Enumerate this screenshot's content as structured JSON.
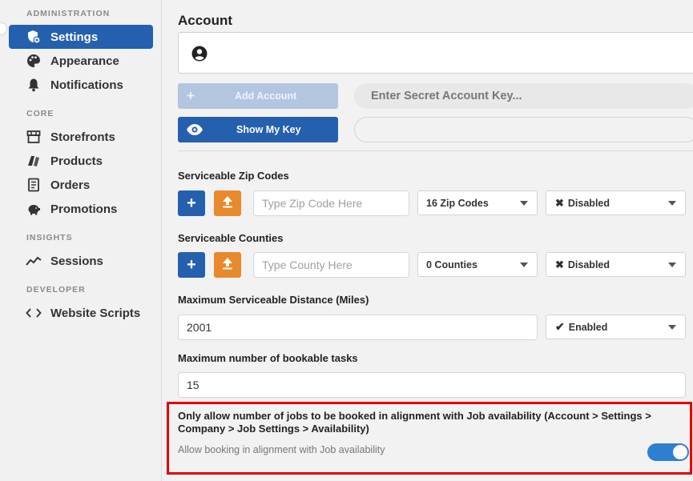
{
  "sidebar": {
    "sections": [
      {
        "title": "ADMINISTRATION"
      },
      {
        "title": "CORE"
      },
      {
        "title": "INSIGHTS"
      },
      {
        "title": "DEVELOPER"
      }
    ],
    "items": [
      {
        "label": "Settings",
        "icon": "shield-gear-icon",
        "active": true
      },
      {
        "label": "Appearance",
        "icon": "palette-icon"
      },
      {
        "label": "Notifications",
        "icon": "bell-icon"
      },
      {
        "label": "Storefronts",
        "icon": "storefront-icon"
      },
      {
        "label": "Products",
        "icon": "products-icon"
      },
      {
        "label": "Orders",
        "icon": "orders-icon"
      },
      {
        "label": "Promotions",
        "icon": "piggy-bank-icon"
      },
      {
        "label": "Sessions",
        "icon": "chart-line-icon"
      },
      {
        "label": "Website Scripts",
        "icon": "code-icon"
      }
    ]
  },
  "account": {
    "title": "Account",
    "add_account_label": "Add Account",
    "show_key_label": "Show My Key",
    "secret_key_placeholder": "Enter Secret Account Key...",
    "key_value": ""
  },
  "zip": {
    "label": "Serviceable Zip Codes",
    "placeholder": "Type Zip Code Here",
    "count": "16 Zip Codes",
    "status": "Disabled"
  },
  "counties": {
    "label": "Serviceable Counties",
    "placeholder": "Type County Here",
    "count": "0 Counties",
    "status": "Disabled"
  },
  "distance": {
    "label": "Maximum Serviceable Distance (Miles)",
    "value": "2001",
    "status": "Enabled"
  },
  "tasks": {
    "label": "Maximum number of bookable tasks",
    "value": "15"
  },
  "availability": {
    "title": "Only allow number of jobs to be booked in alignment with Job availability (Account > Settings > Company > Job Settings > Availability)",
    "toggle_label": "Allow booking in alignment with Job availability",
    "enabled": true
  },
  "colors": {
    "primary": "#2460ad",
    "orange": "#e8892b",
    "highlight": "#e00000",
    "toggle": "#2e7fd1"
  }
}
